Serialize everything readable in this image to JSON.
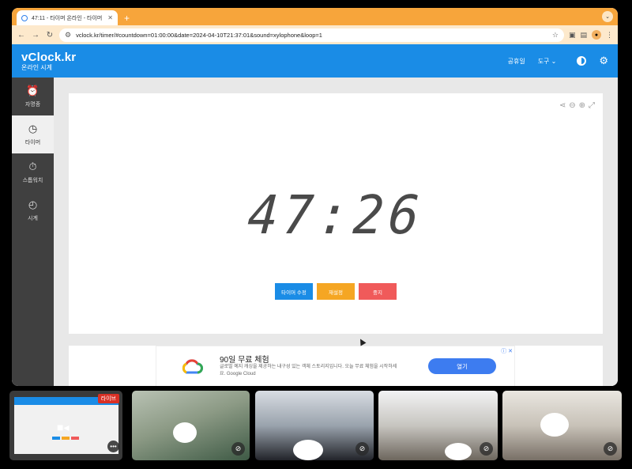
{
  "browser": {
    "tab_title": "47:11 - 타이머 온라인 - 타이머 - ...",
    "tab_close": "✕",
    "new_tab": "+",
    "url": "vclock.kr/timer/#countdown=01:00:00&date=2024-04-10T21:37:01&sound=xylophone&loop=1"
  },
  "site": {
    "logo": "vClock.kr",
    "logo_sub": "온라인 시계",
    "nav": {
      "holidays": "공휴일",
      "tools": "도구 ⌄"
    }
  },
  "sidebar": {
    "items": [
      {
        "label": "자명종",
        "icon": "⏰"
      },
      {
        "label": "타이머",
        "icon": "◷"
      },
      {
        "label": "스톱워치",
        "icon": "⏱"
      },
      {
        "label": "시계",
        "icon": "◴"
      }
    ]
  },
  "timer": {
    "display": "47:26",
    "buttons": {
      "edit": "타이머 수정",
      "reset": "재설정",
      "stop": "중지"
    }
  },
  "ad": {
    "title": "90일 무료 체험",
    "description": "글로벌 예지 캐싱을 제공하는 내구성 있는 객체 스토리지입니다. 오늘 무료 체험을 시작하세요. Google Cloud",
    "cta": "열기",
    "close": "ⓘ ✕"
  },
  "meeting": {
    "live_badge": "라이브",
    "more": "•••"
  },
  "colors": {
    "tabstrip": "#f7a53b",
    "site_header": "#1a8ce6",
    "btn_edit": "#1a8ce6",
    "btn_reset": "#f5a623",
    "btn_stop": "#f05a5a"
  }
}
